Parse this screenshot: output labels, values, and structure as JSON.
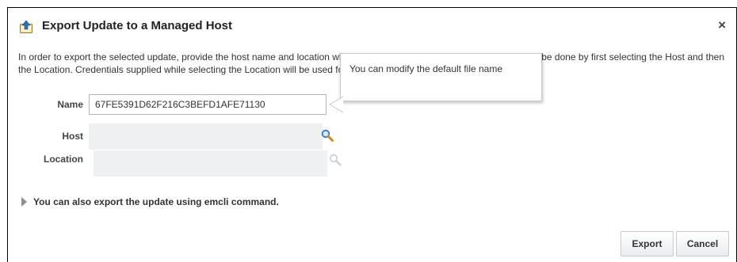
{
  "dialog": {
    "title": "Export Update to a Managed Host",
    "title_icon": "upload-icon",
    "close_label": "×",
    "description": "In order to export the selected update, provide the host name and location where the update needs to be exported. This can be done by first selecting the Host and then the Location. Credentials supplied while selecting the Location will be used for the export operation as well."
  },
  "form": {
    "name_label": "Name",
    "name_value": "67FE5391D62F216C3BEFD1AFE71130",
    "host_label": "Host",
    "host_value": "",
    "host_search_icon": "magnifier-icon",
    "location_label": "Location",
    "location_value": "",
    "location_search_icon": "magnifier-icon"
  },
  "tooltip": {
    "text": "You can modify the default file name"
  },
  "disclosure": {
    "label": "You can also export the update using emcli command."
  },
  "buttons": {
    "export_label": "Export",
    "cancel_label": "Cancel"
  },
  "colors": {
    "dialog_border": "#000000",
    "disabled_field": "#eef0f2",
    "search_icon_active": "#3a78b5",
    "search_icon_disabled": "#c8ccd0"
  }
}
